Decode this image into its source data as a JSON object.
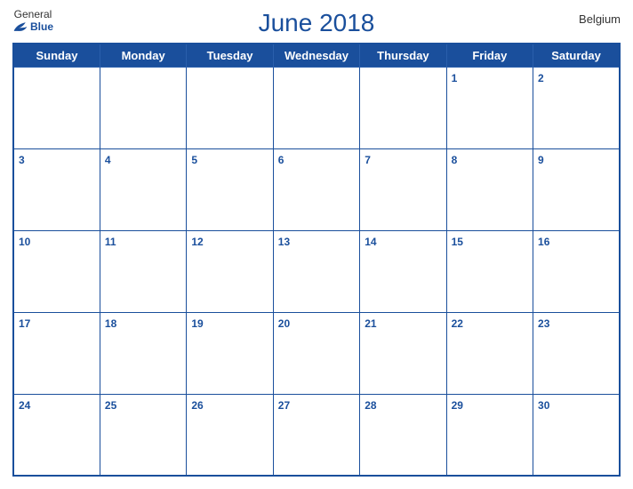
{
  "header": {
    "title": "June 2018",
    "country": "Belgium",
    "logo_general": "General",
    "logo_blue": "Blue"
  },
  "weekdays": [
    "Sunday",
    "Monday",
    "Tuesday",
    "Wednesday",
    "Thursday",
    "Friday",
    "Saturday"
  ],
  "weeks": [
    [
      null,
      null,
      null,
      null,
      null,
      1,
      2
    ],
    [
      3,
      4,
      5,
      6,
      7,
      8,
      9
    ],
    [
      10,
      11,
      12,
      13,
      14,
      15,
      16
    ],
    [
      17,
      18,
      19,
      20,
      21,
      22,
      23
    ],
    [
      24,
      25,
      26,
      27,
      28,
      29,
      30
    ]
  ],
  "colors": {
    "primary": "#1a4f9c",
    "white": "#ffffff",
    "text_dark": "#333333"
  }
}
